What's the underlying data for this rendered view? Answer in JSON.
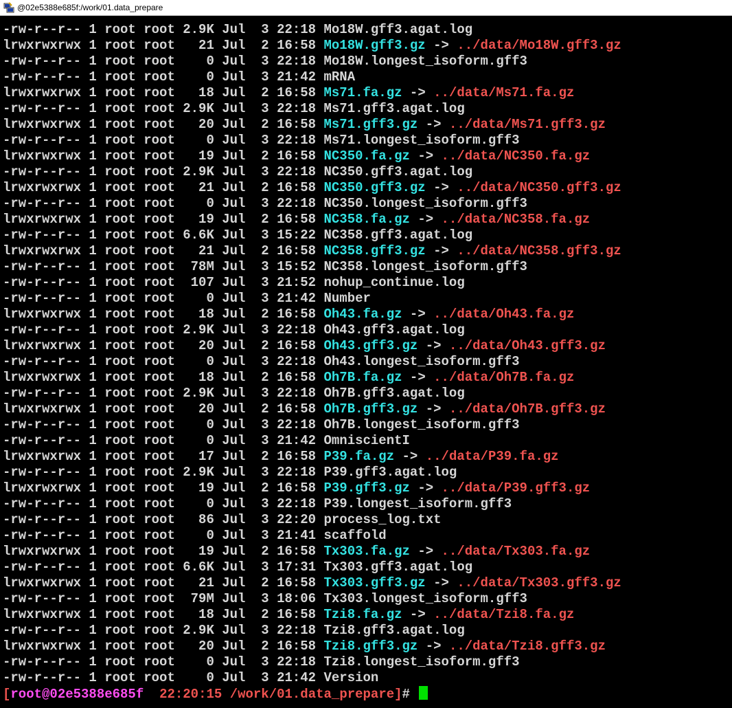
{
  "window": {
    "title": "@02e5388e685f:/work/01.data_prepare",
    "icon": "putty-icon"
  },
  "listing": [
    {
      "meta": "-rw-r--r-- 1 root root 2.9K Jul  3 22:18",
      "name": "Mo18W.gff3.agat.log",
      "link": false
    },
    {
      "meta": "lrwxrwxrwx 1 root root   21 Jul  2 16:58",
      "name": "Mo18W.gff3.gz",
      "link": true,
      "target": "../data/Mo18W.gff3.gz"
    },
    {
      "meta": "-rw-r--r-- 1 root root    0 Jul  3 22:18",
      "name": "Mo18W.longest_isoform.gff3",
      "link": false
    },
    {
      "meta": "-rw-r--r-- 1 root root    0 Jul  3 21:42",
      "name": "mRNA",
      "link": false
    },
    {
      "meta": "lrwxrwxrwx 1 root root   18 Jul  2 16:58",
      "name": "Ms71.fa.gz",
      "link": true,
      "target": "../data/Ms71.fa.gz"
    },
    {
      "meta": "-rw-r--r-- 1 root root 2.9K Jul  3 22:18",
      "name": "Ms71.gff3.agat.log",
      "link": false
    },
    {
      "meta": "lrwxrwxrwx 1 root root   20 Jul  2 16:58",
      "name": "Ms71.gff3.gz",
      "link": true,
      "target": "../data/Ms71.gff3.gz"
    },
    {
      "meta": "-rw-r--r-- 1 root root    0 Jul  3 22:18",
      "name": "Ms71.longest_isoform.gff3",
      "link": false
    },
    {
      "meta": "lrwxrwxrwx 1 root root   19 Jul  2 16:58",
      "name": "NC350.fa.gz",
      "link": true,
      "target": "../data/NC350.fa.gz"
    },
    {
      "meta": "-rw-r--r-- 1 root root 2.9K Jul  3 22:18",
      "name": "NC350.gff3.agat.log",
      "link": false
    },
    {
      "meta": "lrwxrwxrwx 1 root root   21 Jul  2 16:58",
      "name": "NC350.gff3.gz",
      "link": true,
      "target": "../data/NC350.gff3.gz"
    },
    {
      "meta": "-rw-r--r-- 1 root root    0 Jul  3 22:18",
      "name": "NC350.longest_isoform.gff3",
      "link": false
    },
    {
      "meta": "lrwxrwxrwx 1 root root   19 Jul  2 16:58",
      "name": "NC358.fa.gz",
      "link": true,
      "target": "../data/NC358.fa.gz"
    },
    {
      "meta": "-rw-r--r-- 1 root root 6.6K Jul  3 15:22",
      "name": "NC358.gff3.agat.log",
      "link": false
    },
    {
      "meta": "lrwxrwxrwx 1 root root   21 Jul  2 16:58",
      "name": "NC358.gff3.gz",
      "link": true,
      "target": "../data/NC358.gff3.gz"
    },
    {
      "meta": "-rw-r--r-- 1 root root  78M Jul  3 15:52",
      "name": "NC358.longest_isoform.gff3",
      "link": false
    },
    {
      "meta": "-rw-r--r-- 1 root root  107 Jul  3 21:52",
      "name": "nohup_continue.log",
      "link": false
    },
    {
      "meta": "-rw-r--r-- 1 root root    0 Jul  3 21:42",
      "name": "Number",
      "link": false
    },
    {
      "meta": "lrwxrwxrwx 1 root root   18 Jul  2 16:58",
      "name": "Oh43.fa.gz",
      "link": true,
      "target": "../data/Oh43.fa.gz"
    },
    {
      "meta": "-rw-r--r-- 1 root root 2.9K Jul  3 22:18",
      "name": "Oh43.gff3.agat.log",
      "link": false
    },
    {
      "meta": "lrwxrwxrwx 1 root root   20 Jul  2 16:58",
      "name": "Oh43.gff3.gz",
      "link": true,
      "target": "../data/Oh43.gff3.gz"
    },
    {
      "meta": "-rw-r--r-- 1 root root    0 Jul  3 22:18",
      "name": "Oh43.longest_isoform.gff3",
      "link": false
    },
    {
      "meta": "lrwxrwxrwx 1 root root   18 Jul  2 16:58",
      "name": "Oh7B.fa.gz",
      "link": true,
      "target": "../data/Oh7B.fa.gz"
    },
    {
      "meta": "-rw-r--r-- 1 root root 2.9K Jul  3 22:18",
      "name": "Oh7B.gff3.agat.log",
      "link": false
    },
    {
      "meta": "lrwxrwxrwx 1 root root   20 Jul  2 16:58",
      "name": "Oh7B.gff3.gz",
      "link": true,
      "target": "../data/Oh7B.gff3.gz"
    },
    {
      "meta": "-rw-r--r-- 1 root root    0 Jul  3 22:18",
      "name": "Oh7B.longest_isoform.gff3",
      "link": false
    },
    {
      "meta": "-rw-r--r-- 1 root root    0 Jul  3 21:42",
      "name": "OmniscientI",
      "link": false
    },
    {
      "meta": "lrwxrwxrwx 1 root root   17 Jul  2 16:58",
      "name": "P39.fa.gz",
      "link": true,
      "target": "../data/P39.fa.gz"
    },
    {
      "meta": "-rw-r--r-- 1 root root 2.9K Jul  3 22:18",
      "name": "P39.gff3.agat.log",
      "link": false
    },
    {
      "meta": "lrwxrwxrwx 1 root root   19 Jul  2 16:58",
      "name": "P39.gff3.gz",
      "link": true,
      "target": "../data/P39.gff3.gz"
    },
    {
      "meta": "-rw-r--r-- 1 root root    0 Jul  3 22:18",
      "name": "P39.longest_isoform.gff3",
      "link": false
    },
    {
      "meta": "-rw-r--r-- 1 root root   86 Jul  3 22:20",
      "name": "process_log.txt",
      "link": false
    },
    {
      "meta": "-rw-r--r-- 1 root root    0 Jul  3 21:41",
      "name": "scaffold",
      "link": false
    },
    {
      "meta": "lrwxrwxrwx 1 root root   19 Jul  2 16:58",
      "name": "Tx303.fa.gz",
      "link": true,
      "target": "../data/Tx303.fa.gz"
    },
    {
      "meta": "-rw-r--r-- 1 root root 6.6K Jul  3 17:31",
      "name": "Tx303.gff3.agat.log",
      "link": false
    },
    {
      "meta": "lrwxrwxrwx 1 root root   21 Jul  2 16:58",
      "name": "Tx303.gff3.gz",
      "link": true,
      "target": "../data/Tx303.gff3.gz"
    },
    {
      "meta": "-rw-r--r-- 1 root root  79M Jul  3 18:06",
      "name": "Tx303.longest_isoform.gff3",
      "link": false
    },
    {
      "meta": "lrwxrwxrwx 1 root root   18 Jul  2 16:58",
      "name": "Tzi8.fa.gz",
      "link": true,
      "target": "../data/Tzi8.fa.gz"
    },
    {
      "meta": "-rw-r--r-- 1 root root 2.9K Jul  3 22:18",
      "name": "Tzi8.gff3.agat.log",
      "link": false
    },
    {
      "meta": "lrwxrwxrwx 1 root root   20 Jul  2 16:58",
      "name": "Tzi8.gff3.gz",
      "link": true,
      "target": "../data/Tzi8.gff3.gz"
    },
    {
      "meta": "-rw-r--r-- 1 root root    0 Jul  3 22:18",
      "name": "Tzi8.longest_isoform.gff3",
      "link": false
    },
    {
      "meta": "-rw-r--r-- 1 root root    0 Jul  3 21:42",
      "name": "Version",
      "link": false
    }
  ],
  "prompt": {
    "open": "[",
    "user": "root@02e5388e685f",
    "time": "22:20:15",
    "dir": "/work/01.data_prepare",
    "close": "]",
    "hash": "#"
  },
  "colors": {
    "background": "#000000",
    "text": "#d6d6d6",
    "link": "#34e2e2",
    "target": "#ef5350",
    "user": "#ff4df2",
    "cursor": "#00e000"
  }
}
